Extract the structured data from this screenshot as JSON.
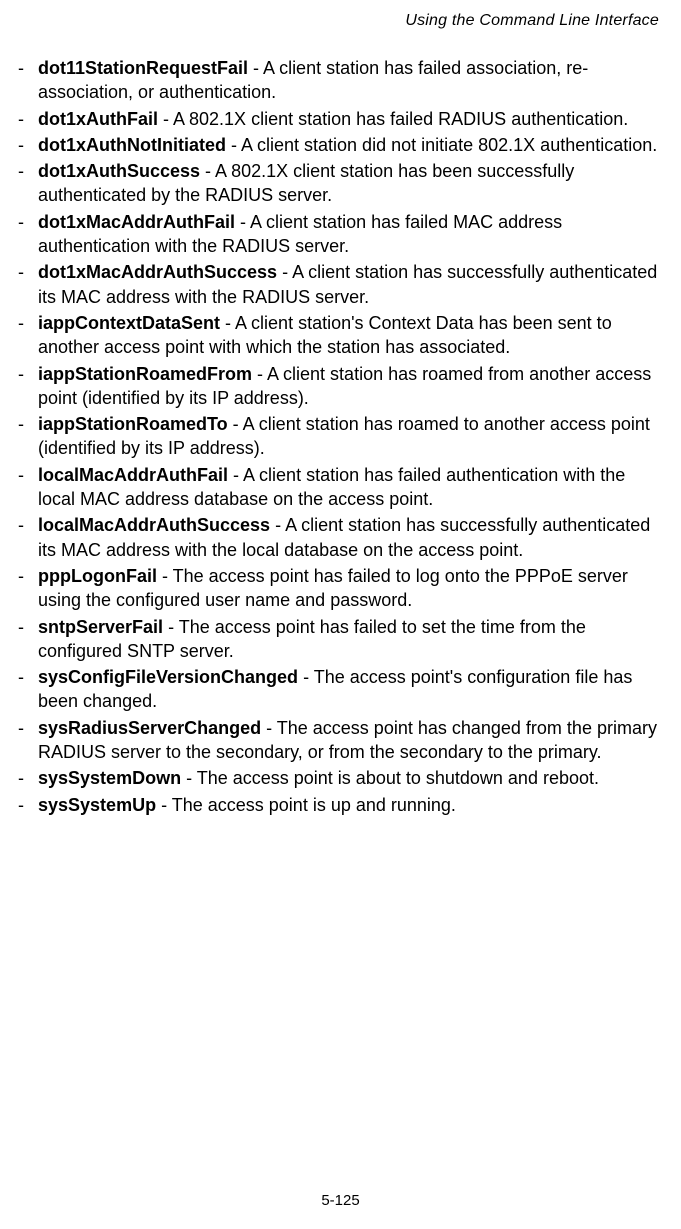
{
  "header": "Using the Command Line Interface",
  "footer": "5-125",
  "items": [
    {
      "term": "dot11StationRequestFail",
      "desc": " - A client station has failed association, re-association, or authentication."
    },
    {
      "term": "dot1xAuthFail",
      "desc": " - A 802.1X client station has failed RADIUS authentication."
    },
    {
      "term": "dot1xAuthNotInitiated",
      "desc": " - A client station did not initiate 802.1X authentication."
    },
    {
      "term": "dot1xAuthSuccess",
      "desc": " - A 802.1X client station has been successfully authenticated by the RADIUS server."
    },
    {
      "term": "dot1xMacAddrAuthFail",
      "desc": " - A client station has failed MAC address authentication with the RADIUS server."
    },
    {
      "term": "dot1xMacAddrAuthSuccess",
      "desc": " - A client station has successfully authenticated its MAC address with the RADIUS server."
    },
    {
      "term": "iappContextDataSent",
      "desc": " - A client station's Context Data has been sent to another access point with which the station has associated."
    },
    {
      "term": "iappStationRoamedFrom",
      "desc": " - A client station has roamed from another access point (identified by its IP address)."
    },
    {
      "term": "iappStationRoamedTo",
      "desc": " - A client station has roamed to another access point (identified by its IP address)."
    },
    {
      "term": "localMacAddrAuthFail",
      "desc": " - A client station has failed authentication with the local MAC address database on the access point."
    },
    {
      "term": "localMacAddrAuthSuccess",
      "desc": " - A client station has successfully authenticated its MAC address with the local database on the access point."
    },
    {
      "term": "pppLogonFail",
      "desc": " - The access point has failed to log onto the PPPoE server using the configured user name and password."
    },
    {
      "term": "sntpServerFail",
      "desc": " - The access point has failed to set the time from the configured SNTP server."
    },
    {
      "term": "sysConfigFileVersionChanged",
      "desc": " - The access point's configuration file has been changed."
    },
    {
      "term": "sysRadiusServerChanged",
      "desc": " - The access point has changed from the primary RADIUS server to the secondary, or from the secondary to the primary."
    },
    {
      "term": "sysSystemDown",
      "desc": " - The access point is about to shutdown and reboot."
    },
    {
      "term": "sysSystemUp",
      "desc": " - The access point is up and running."
    }
  ]
}
